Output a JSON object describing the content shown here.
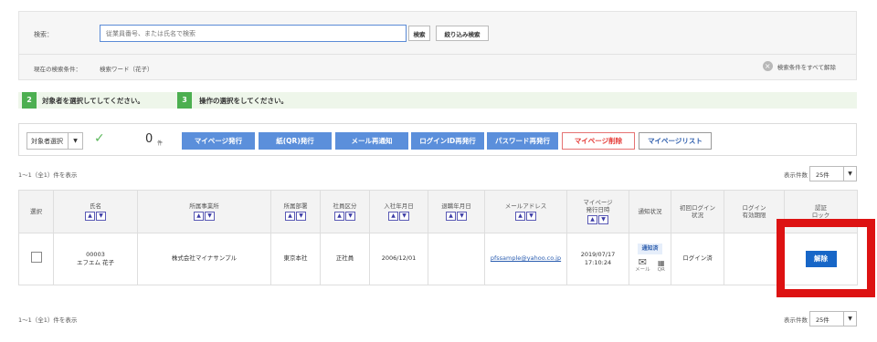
{
  "search": {
    "label": "検索：",
    "placeholder": "従業員番号、または氏名で検索",
    "search_button": "検索",
    "filter_button": "絞り込み検索",
    "current_condition_label": "現在の検索条件：",
    "current_condition_value": "検索ワード（花子）",
    "clear_all_label": "検索条件をすべて解除",
    "clear_icon": "close-circle-icon"
  },
  "steps": [
    {
      "number": "2",
      "text": "対象者を選択してしてください。"
    },
    {
      "number": "3",
      "text": "操作の選択をしてください。"
    }
  ],
  "action_bar": {
    "target_select_label": "対象者選択",
    "check_icon": "check-icon",
    "selected_count": "0",
    "count_unit": "件",
    "buttons": [
      {
        "label": "マイページ発行",
        "style": "blue"
      },
      {
        "label": "紙(QR)発行",
        "style": "blue"
      },
      {
        "label": "メール再通知",
        "style": "blue"
      },
      {
        "label": "ログインID再発行",
        "style": "blue"
      },
      {
        "label": "パスワード再発行",
        "style": "blue"
      },
      {
        "label": "マイページ削除",
        "style": "red"
      },
      {
        "label": "マイページリスト",
        "style": "outline"
      }
    ]
  },
  "results": {
    "count_text": "1〜1（全1）件を表示",
    "per_page_label": "表示件数",
    "per_page_value": "25件"
  },
  "table": {
    "headers": [
      {
        "label": "選択"
      },
      {
        "label": "氏名"
      },
      {
        "label": "所属事業所"
      },
      {
        "label": "所属部署"
      },
      {
        "label": "社員区分"
      },
      {
        "label": "入社年月日"
      },
      {
        "label": "退職年月日"
      },
      {
        "label": "メールアドレス"
      },
      {
        "label": "マイページ\n発行日時"
      },
      {
        "label": "通知状況"
      },
      {
        "label": "初回ログイン\n状況"
      },
      {
        "label": "ログイン\n有効期限"
      },
      {
        "label": "認証\nロック"
      }
    ],
    "rows": [
      {
        "employee_no": "00003",
        "name": "エフエム 花子",
        "office": "株式会社マイナサンプル",
        "department": "東京本社",
        "category": "正社員",
        "hire_date": "2006/12/01",
        "retire_date": "",
        "email": "pfssample@yahoo.co.jp",
        "issue_date": "2019/07/17",
        "issue_time": "17:10:24",
        "notification_badge": "通知済",
        "notification_mail_label": "メール",
        "notification_qr_label": "QR",
        "first_login": "ログイン済",
        "login_expiry": "",
        "unlock_button": "解除"
      }
    ]
  },
  "colors": {
    "accent_blue": "#5b8fdb",
    "unlock_blue": "#1766c7",
    "step_green": "#4caf50",
    "highlight_red": "#dd1212",
    "delete_red": "#e53935"
  }
}
